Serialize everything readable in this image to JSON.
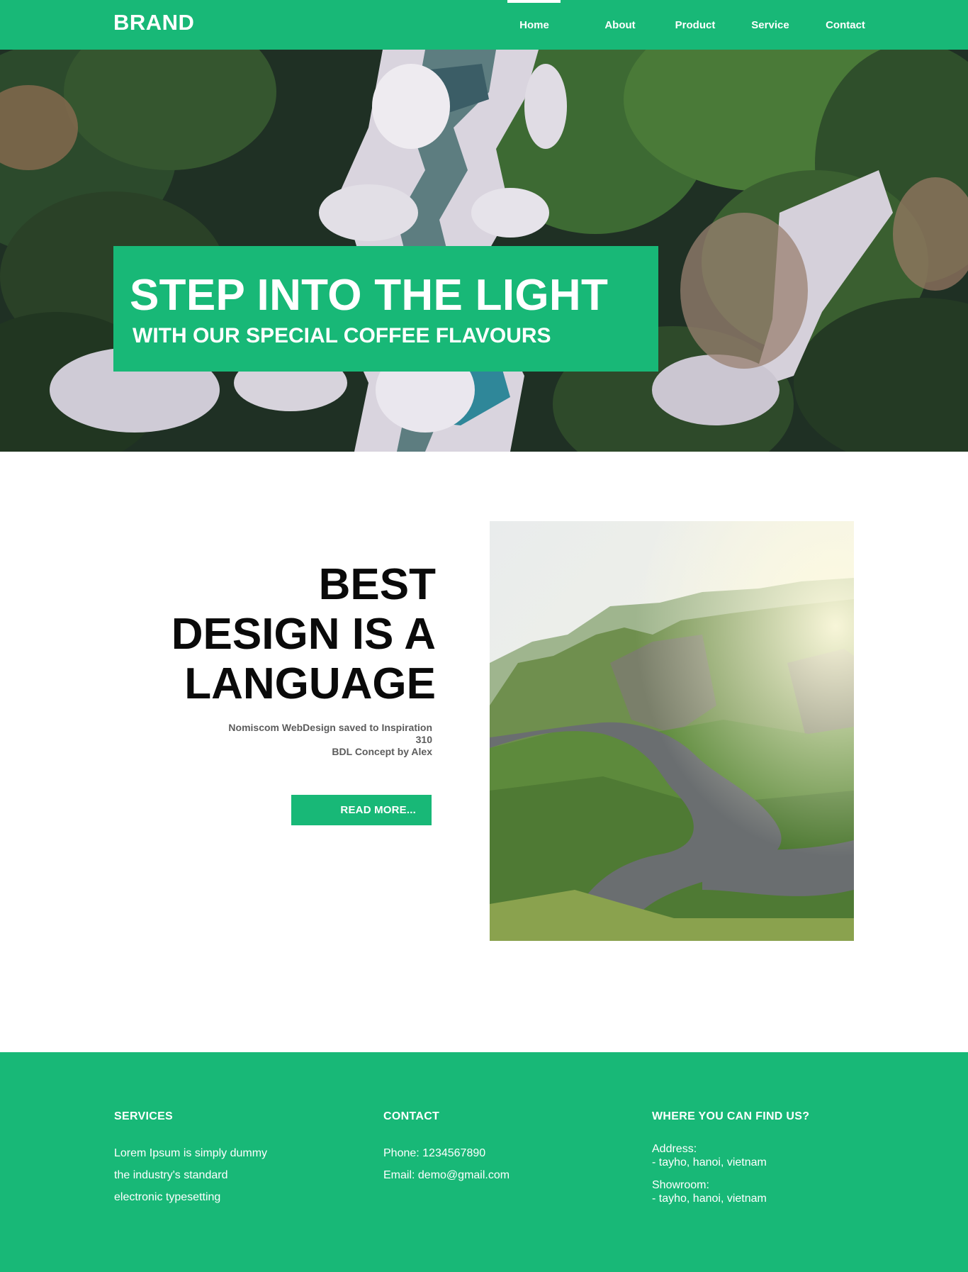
{
  "header": {
    "brand": "BRAND",
    "nav": [
      "Home",
      "About",
      "Product",
      "Service",
      "Contact"
    ],
    "active": "Home"
  },
  "hero": {
    "title": "STEP INTO THE LIGHT",
    "subtitle": "WITH OUR SPECIAL COFFEE FLAVOURS"
  },
  "feature": {
    "heading": [
      "BEST",
      "DESIGN IS A",
      "LANGUAGE"
    ],
    "meta": [
      "Nomiscom WebDesign saved to Inspiration",
      "310",
      "BDL Concept by Alex"
    ],
    "button": "READ MORE..."
  },
  "footer": {
    "services": {
      "title": "SERVICES",
      "lines": [
        "Lorem Ipsum is simply dummy",
        "the industry's standard",
        "electronic typesetting"
      ]
    },
    "contact": {
      "title": "CONTACT",
      "phone": "Phone: 1234567890",
      "email": "Email: demo@gmail.com"
    },
    "location": {
      "title": "WHERE YOU CAN FIND US?",
      "address_label": "Address:",
      "address": "- tayho, hanoi, vietnam",
      "showroom_label": "Showroom:",
      "showroom": "- tayho, hanoi, vietnam"
    }
  },
  "colors": {
    "brand_green": "#18b877",
    "white": "#ffffff",
    "heading_black": "#0a0a0a",
    "meta_gray": "#5c5c5c"
  }
}
